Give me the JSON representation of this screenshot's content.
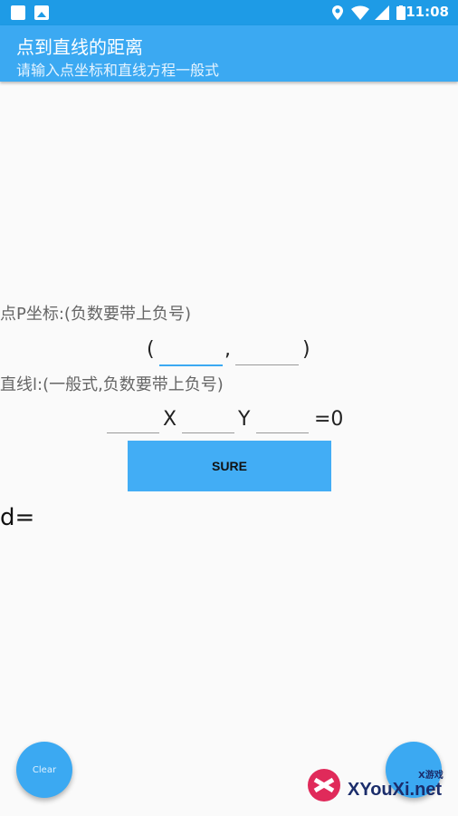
{
  "status_bar": {
    "time": "11:08"
  },
  "app_bar": {
    "title": "点到直线的距离",
    "subtitle": "请输入点坐标和直线方程一般式"
  },
  "point": {
    "label": "点P坐标:(负数要带上负号)",
    "open_paren": "(",
    "comma": ",",
    "close_paren": ")",
    "x_value": "",
    "y_value": ""
  },
  "line": {
    "label": "直线l:(一般式,负数要带上负号)",
    "x_symbol": "X",
    "y_symbol": "Y",
    "equals": "=0",
    "a_value": "",
    "b_value": "",
    "c_value": ""
  },
  "sure_button": "SURE",
  "result": {
    "prefix": "d="
  },
  "clear_fab": "Clear",
  "watermark": {
    "big": "XYouXi.net",
    "small": "X游戏"
  },
  "colors": {
    "primary": "#3ba9f2",
    "status": "#1e9be6",
    "button": "#42adf5"
  }
}
